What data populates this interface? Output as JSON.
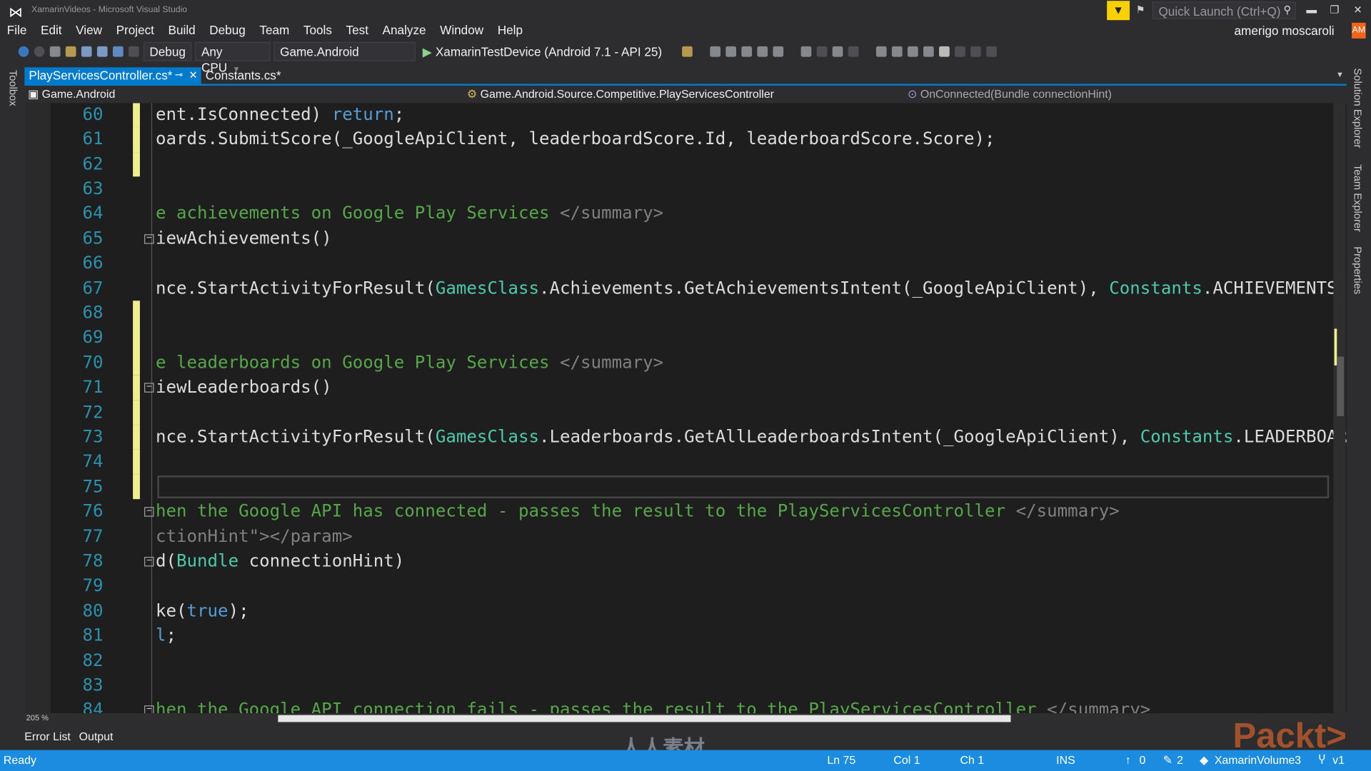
{
  "window": {
    "title": "XamarinVideos - Microsoft Visual Studio",
    "quick_launch_placeholder": "Quick Launch (Ctrl+Q)",
    "user": "amerigo moscaroli",
    "avatar": "AM"
  },
  "menu": [
    "File",
    "Edit",
    "View",
    "Project",
    "Build",
    "Debug",
    "Team",
    "Tools",
    "Test",
    "Analyze",
    "Window",
    "Help"
  ],
  "toolbar": {
    "configuration": "Debug",
    "platform": "Any CPU",
    "startup_project": "Game.Android",
    "run_target": "XamarinTestDevice (Android 7.1 - API 25)"
  },
  "tabs": [
    {
      "label": "PlayServicesController.cs*",
      "active": true
    },
    {
      "label": "Constants.cs*",
      "active": false
    }
  ],
  "navbar": {
    "project": "Game.Android",
    "type": "Game.Android.Source.Competitive.PlayServicesController",
    "member": "OnConnected(Bundle connectionHint)"
  },
  "side_left": [
    "Toolbox"
  ],
  "side_right": [
    "Solution Explorer",
    "Team Explorer",
    "Properties"
  ],
  "code": {
    "current_line": 75,
    "lines": [
      {
        "n": "60",
        "chg": true,
        "t": [
          [
            "ent.IsConnected) ",
            ""
          ],
          [
            "return",
            "kw"
          ],
          [
            ";",
            ""
          ]
        ]
      },
      {
        "n": "61",
        "chg": true,
        "t": [
          [
            "oards.SubmitScore(_GoogleApiClient, leaderboardScore.Id, leaderboardScore.Score);",
            ""
          ]
        ]
      },
      {
        "n": "62",
        "chg": true,
        "t": []
      },
      {
        "n": "63",
        "t": []
      },
      {
        "n": "64",
        "t": [
          [
            "e achievements on Google Play Services ",
            "cm"
          ],
          [
            "</summary>",
            "cg"
          ]
        ]
      },
      {
        "n": "65",
        "fold": true,
        "t": [
          [
            "iewAchievements()",
            ""
          ]
        ]
      },
      {
        "n": "66",
        "t": []
      },
      {
        "n": "67",
        "t": [
          [
            "nce.StartActivityForResult(",
            ""
          ],
          [
            "GamesClass",
            "ty"
          ],
          [
            ".Achievements.GetAchievementsIntent(_GoogleApiClient), ",
            ""
          ],
          [
            "Constants",
            "ty"
          ],
          [
            ".ACHIEVEMENTS",
            ""
          ]
        ]
      },
      {
        "n": "68",
        "chg": true,
        "t": []
      },
      {
        "n": "69",
        "chg": true,
        "t": []
      },
      {
        "n": "70",
        "chg": true,
        "t": [
          [
            "e leaderboards on Google Play Services ",
            "cm"
          ],
          [
            "</summary>",
            "cg"
          ]
        ]
      },
      {
        "n": "71",
        "chg": true,
        "fold": true,
        "t": [
          [
            "iewLeaderboards()",
            ""
          ]
        ]
      },
      {
        "n": "72",
        "chg": true,
        "t": []
      },
      {
        "n": "73",
        "chg": true,
        "t": [
          [
            "nce.StartActivityForResult(",
            ""
          ],
          [
            "GamesClass",
            "ty"
          ],
          [
            ".Leaderboards.GetAllLeaderboardsIntent(_GoogleApiClient), ",
            ""
          ],
          [
            "Constants",
            "ty"
          ],
          [
            ".LEADERBOARDS",
            ""
          ]
        ]
      },
      {
        "n": "74",
        "chg": true,
        "t": []
      },
      {
        "n": "75",
        "chg": true,
        "t": []
      },
      {
        "n": "76",
        "fold": true,
        "t": [
          [
            "hen the Google API has connected - passes the result to the PlayServicesController ",
            "cm"
          ],
          [
            "</summary>",
            "cg"
          ]
        ]
      },
      {
        "n": "77",
        "t": [
          [
            "ctionHint\"",
            "cg"
          ],
          [
            "></param>",
            "cg"
          ]
        ]
      },
      {
        "n": "78",
        "fold": true,
        "t": [
          [
            "d(",
            ""
          ],
          [
            "Bundle",
            "ty"
          ],
          [
            " connectionHint)",
            ""
          ]
        ]
      },
      {
        "n": "79",
        "t": []
      },
      {
        "n": "80",
        "t": [
          [
            "ke(",
            ""
          ],
          [
            "true",
            "kw"
          ],
          [
            ");",
            ""
          ]
        ]
      },
      {
        "n": "81",
        "t": [
          [
            "l",
            "kw"
          ],
          [
            ";",
            ""
          ]
        ]
      },
      {
        "n": "82",
        "t": []
      },
      {
        "n": "83",
        "t": []
      },
      {
        "n": "84",
        "fold": true,
        "t": [
          [
            "hen the Google API connection fails - passes the result to the PlayServicesController ",
            "cm"
          ],
          [
            "</summary>",
            "cg"
          ]
        ]
      }
    ]
  },
  "zoom_level": "205 %",
  "bottom_tabs": [
    "Error List",
    "Output"
  ],
  "status": {
    "state": "Ready",
    "ln": "Ln 75",
    "col": "Col 1",
    "ch": "Ch 1",
    "mode": "INS",
    "up": "0",
    "pending": "2",
    "repo": "XamarinVolume3",
    "branch": "v1"
  },
  "watermarks": {
    "center": "人人素材",
    "logo": "Packt>"
  },
  "colors": {
    "accent": "#007acc",
    "status_bar": "#1c8ce0",
    "change_marker": "#efef8f",
    "line_number": "#2b91af",
    "keyword": "#569cd6",
    "type": "#4ec9b0",
    "comment": "#57a64a"
  }
}
